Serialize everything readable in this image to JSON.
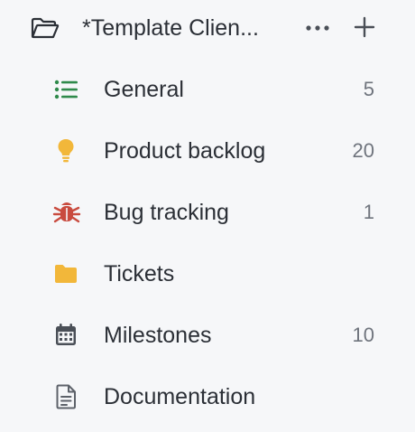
{
  "header": {
    "title": "*Template Clien...",
    "folder_icon": "folder-open-icon",
    "more_icon": "more-horizontal-icon",
    "add_icon": "plus-icon"
  },
  "colors": {
    "list_green": "#2f8a4b",
    "bulb_yellow": "#f2b73a",
    "bug_red": "#c94b3f",
    "folder_yellow": "#f2b73a",
    "calendar_gray": "#4a4f57",
    "doc_gray": "#5d626a",
    "text": "#2b2f36",
    "count": "#6f747d"
  },
  "items": [
    {
      "label": "General",
      "count": "5",
      "icon": "list-icon"
    },
    {
      "label": "Product backlog",
      "count": "20",
      "icon": "lightbulb-icon"
    },
    {
      "label": "Bug tracking",
      "count": "1",
      "icon": "bug-icon"
    },
    {
      "label": "Tickets",
      "count": "",
      "icon": "folder-icon"
    },
    {
      "label": "Milestones",
      "count": "10",
      "icon": "calendar-icon"
    },
    {
      "label": "Documentation",
      "count": "",
      "icon": "document-icon"
    }
  ]
}
